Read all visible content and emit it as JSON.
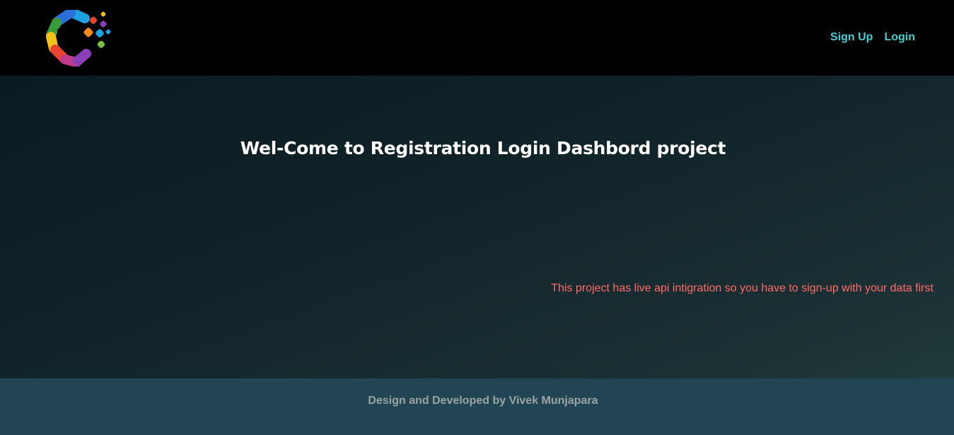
{
  "header": {
    "logo_icon": "colorful-c-logo-icon",
    "nav_links": [
      "Sign Up",
      "Login"
    ],
    "link_color": "#3fd0d4"
  },
  "hero": {
    "title": "Wel-Come to Registration Login Dashbord project",
    "notice": "This project has live api intigration so you have to sign-up with your data first",
    "notice_color": "#ff6b6b"
  },
  "footer": {
    "credit": "Design and Developed by Vivek Munjapara",
    "background": "#224553"
  }
}
